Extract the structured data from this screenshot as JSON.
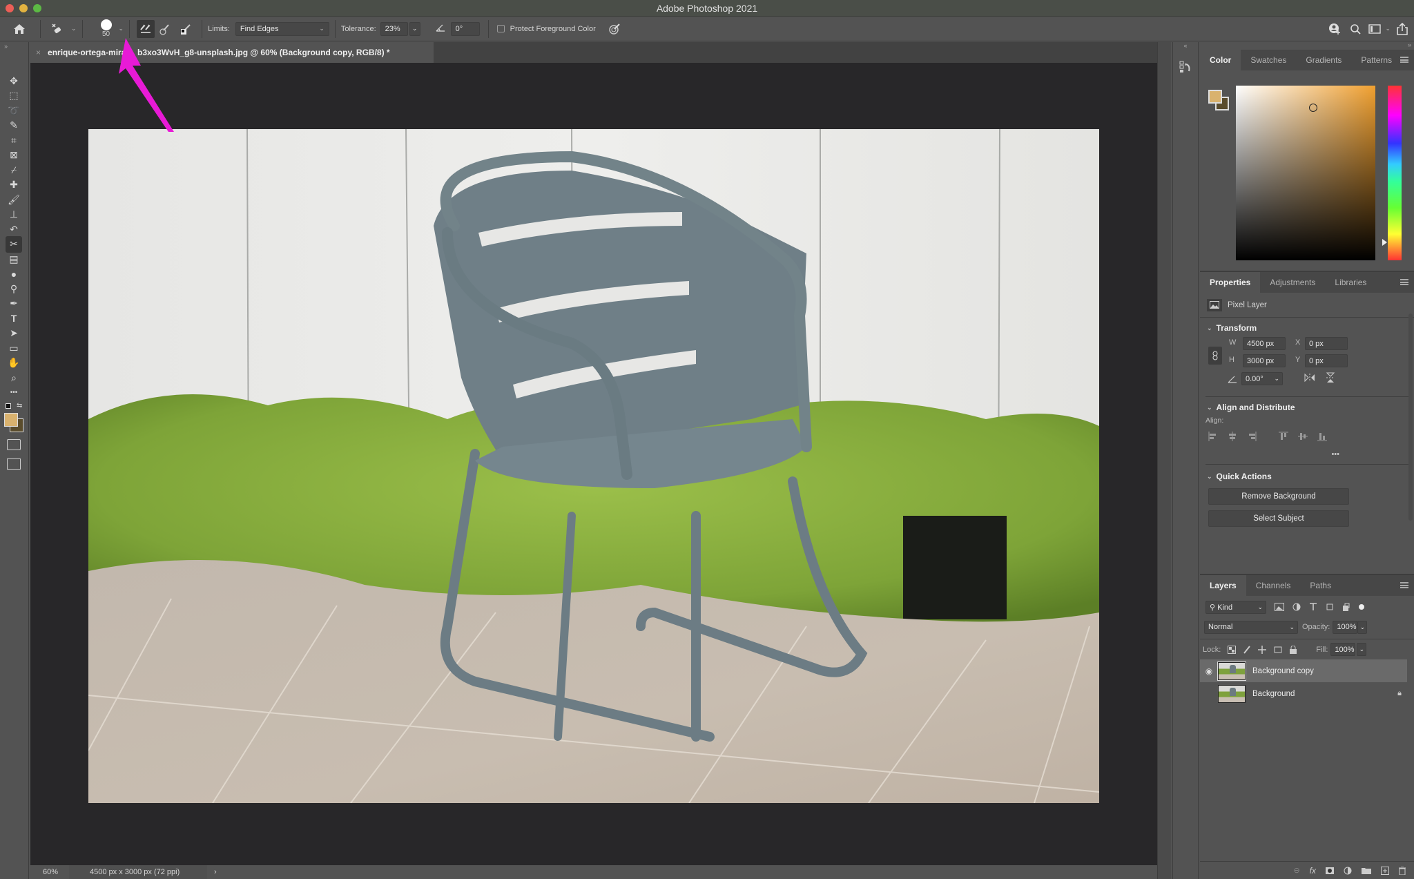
{
  "window": {
    "title": "Adobe Photoshop 2021"
  },
  "options_bar": {
    "brush_size": "50",
    "limits_label": "Limits:",
    "limits_value": "Find Edges",
    "tolerance_label": "Tolerance:",
    "tolerance_value": "23%",
    "angle_value": "0°",
    "protect_foreground_label": "Protect Foreground Color",
    "protect_foreground_checked": false,
    "sampling_modes": [
      "sampling-continuous",
      "sampling-once",
      "sampling-background-swatch"
    ],
    "active_sampling_mode": "sampling-continuous",
    "right_icons": [
      "share-user-icon",
      "search-icon",
      "workspace-icon",
      "share-icon"
    ]
  },
  "document": {
    "tab_title": "enrique-ortega-mira     b3xo3WvH_g8-unsplash.jpg @ 60% (Background copy, RGB/8) *",
    "image_description": "Grey metal patio chair in front of white wooden fence with green shrubs, on wood-look tile floor"
  },
  "annotation": {
    "type": "arrow",
    "color": "#e81ad6",
    "points_to": "sampling-continuous"
  },
  "toolbar": {
    "tools": [
      "move-tool",
      "marquee-tool",
      "lasso-tool",
      "quick-selection-tool",
      "crop-tool",
      "frame-tool",
      "eyedropper-tool",
      "healing-brush-tool",
      "brush-tool",
      "clone-stamp-tool",
      "history-brush-tool",
      "background-eraser-tool",
      "gradient-tool",
      "blur-tool",
      "dodge-tool",
      "pen-tool",
      "type-tool",
      "path-selection-tool",
      "rectangle-tool",
      "hand-tool",
      "zoom-tool",
      "more-tools"
    ],
    "active_tool": "background-eraser-tool",
    "foreground_color": "#d9b26e",
    "background_color": "#5a4c2c"
  },
  "status": {
    "zoom": "60%",
    "doc_info": "4500 px x 3000 px (72 ppi)"
  },
  "color_panel": {
    "tabs": [
      "Color",
      "Swatches",
      "Gradients",
      "Patterns"
    ],
    "active_tab": "Color",
    "hue_color": "#f0a030",
    "foreground": "#d9b26e",
    "background": "#5a4c2c"
  },
  "properties_panel": {
    "tabs": [
      "Properties",
      "Adjustments",
      "Libraries"
    ],
    "active_tab": "Properties",
    "layer_kind": "Pixel Layer",
    "transform": {
      "title": "Transform",
      "w_label": "W",
      "w": "4500 px",
      "h_label": "H",
      "h": "3000 px",
      "x_label": "X",
      "x": "0 px",
      "y_label": "Y",
      "y": "0 px",
      "angle": "0.00°"
    },
    "align": {
      "title": "Align and Distribute",
      "label": "Align:",
      "more": "•••"
    },
    "quick_actions": {
      "title": "Quick Actions",
      "buttons": [
        "Remove Background",
        "Select Subject"
      ]
    }
  },
  "layers_panel": {
    "tabs": [
      "Layers",
      "Channels",
      "Paths"
    ],
    "active_tab": "Layers",
    "filter_kind": "Kind",
    "blend_mode": "Normal",
    "opacity_label": "Opacity:",
    "opacity": "100%",
    "lock_label": "Lock:",
    "fill_label": "Fill:",
    "fill": "100%",
    "layers": [
      {
        "name": "Background copy",
        "visible": true,
        "selected": true,
        "locked": false
      },
      {
        "name": "Background",
        "visible": false,
        "selected": false,
        "locked": true
      }
    ],
    "footer_icons": [
      "link-layers-icon",
      "fx-icon",
      "add-mask-icon",
      "adjustment-layer-icon",
      "new-group-icon",
      "new-layer-icon",
      "delete-layer-icon"
    ]
  }
}
